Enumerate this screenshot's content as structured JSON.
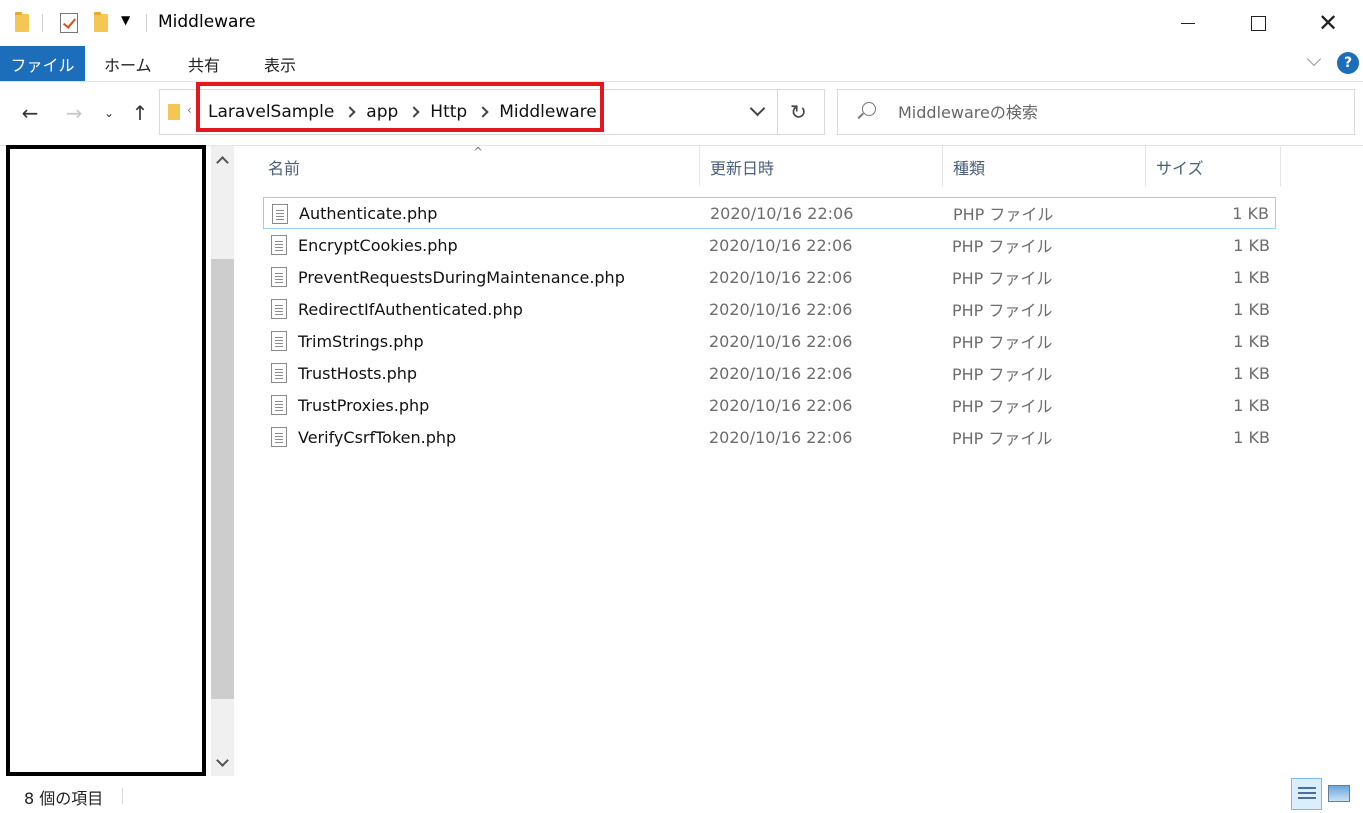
{
  "window": {
    "title": "Middleware"
  },
  "ribbon": {
    "tabs": [
      "ファイル",
      "ホーム",
      "共有",
      "表示"
    ],
    "help_label": "?"
  },
  "address": {
    "crumbs": [
      "LaravelSample",
      "app",
      "Http",
      "Middleware"
    ]
  },
  "search": {
    "placeholder": "Middlewareの検索"
  },
  "columns": {
    "name": "名前",
    "date": "更新日時",
    "type": "種類",
    "size": "サイズ"
  },
  "files": [
    {
      "name": "Authenticate.php",
      "date": "2020/10/16 22:06",
      "type": "PHP ファイル",
      "size": "1 KB"
    },
    {
      "name": "EncryptCookies.php",
      "date": "2020/10/16 22:06",
      "type": "PHP ファイル",
      "size": "1 KB"
    },
    {
      "name": "PreventRequestsDuringMaintenance.php",
      "date": "2020/10/16 22:06",
      "type": "PHP ファイル",
      "size": "1 KB"
    },
    {
      "name": "RedirectIfAuthenticated.php",
      "date": "2020/10/16 22:06",
      "type": "PHP ファイル",
      "size": "1 KB"
    },
    {
      "name": "TrimStrings.php",
      "date": "2020/10/16 22:06",
      "type": "PHP ファイル",
      "size": "1 KB"
    },
    {
      "name": "TrustHosts.php",
      "date": "2020/10/16 22:06",
      "type": "PHP ファイル",
      "size": "1 KB"
    },
    {
      "name": "TrustProxies.php",
      "date": "2020/10/16 22:06",
      "type": "PHP ファイル",
      "size": "1 KB"
    },
    {
      "name": "VerifyCsrfToken.php",
      "date": "2020/10/16 22:06",
      "type": "PHP ファイル",
      "size": "1 KB"
    }
  ],
  "status": {
    "item_count": "8 個の項目"
  },
  "icons": {
    "file": "php-file-icon",
    "folder": "folder-icon"
  },
  "colors": {
    "file_tab": "#1c6dba",
    "highlight_box": "#e3171e",
    "selected_row_border": "#99d1ef"
  }
}
